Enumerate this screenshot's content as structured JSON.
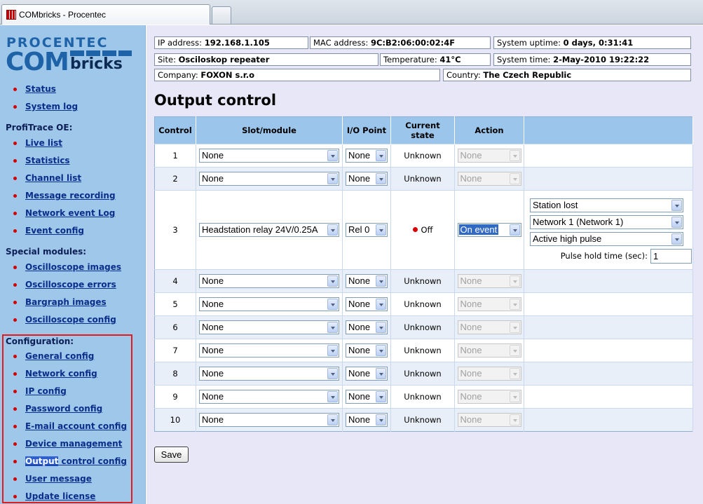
{
  "browser": {
    "tab_title": "COMbricks - Procentec"
  },
  "logo": {
    "top": "PROCENTEC",
    "com": "COM",
    "bricks": "bricks"
  },
  "sidebar": {
    "top_items": [
      "Status",
      "System log"
    ],
    "profitrace_heading": "ProfiTrace OE:",
    "profitrace_items": [
      "Live list",
      "Statistics",
      "Channel list",
      "Message recording",
      "Network event Log",
      "Event config"
    ],
    "special_heading": "Special modules:",
    "special_items": [
      "Oscilloscope images",
      "Oscilloscope errors",
      "Bargraph images",
      "Oscilloscope config"
    ],
    "config_heading": "Configuration:",
    "config_items": [
      "General config",
      "Network config",
      "IP config",
      "Password config",
      "E-mail account config",
      "Device management",
      "Output control config",
      "User message",
      "Update license"
    ],
    "selected_word": "Output",
    "selected_rest": " control config"
  },
  "info": {
    "ip_label": "IP address: ",
    "ip_value": "192.168.1.105",
    "mac_label": "MAC address: ",
    "mac_value": "9C:B2:06:00:02:4F",
    "uptime_label": "System uptime: ",
    "uptime_value": "0 days, 0:31:41",
    "site_label": "Site: ",
    "site_value": "Osciloskop repeater",
    "temp_label": "Temperature: ",
    "temp_value": "41°C",
    "time_label": "System time: ",
    "time_value": "2-May-2010 19:22:22",
    "company_label": "Company: ",
    "company_value": "FOXON s.r.o",
    "country_label": "Country: ",
    "country_value": "The Czech Republic"
  },
  "page_title": "Output control",
  "table": {
    "headers": {
      "control": "Control",
      "slot": "Slot/module",
      "io": "I/O Point",
      "state_line1": "Current",
      "state_line2": "state",
      "action": "Action"
    },
    "rows": [
      {
        "control": "1",
        "slot": "None",
        "io": "None",
        "state": "Unknown",
        "action": "None"
      },
      {
        "control": "2",
        "slot": "None",
        "io": "None",
        "state": "Unknown",
        "action": "None"
      },
      {
        "control": "3",
        "slot": "Headstation relay 24V/0.25A",
        "io": "Rel 0",
        "state": "Off",
        "action": "On event"
      },
      {
        "control": "4",
        "slot": "None",
        "io": "None",
        "state": "Unknown",
        "action": "None"
      },
      {
        "control": "5",
        "slot": "None",
        "io": "None",
        "state": "Unknown",
        "action": "None"
      },
      {
        "control": "6",
        "slot": "None",
        "io": "None",
        "state": "Unknown",
        "action": "None"
      },
      {
        "control": "7",
        "slot": "None",
        "io": "None",
        "state": "Unknown",
        "action": "None"
      },
      {
        "control": "8",
        "slot": "None",
        "io": "None",
        "state": "Unknown",
        "action": "None"
      },
      {
        "control": "9",
        "slot": "None",
        "io": "None",
        "state": "Unknown",
        "action": "None"
      },
      {
        "control": "10",
        "slot": "None",
        "io": "None",
        "state": "Unknown",
        "action": "None"
      }
    ],
    "row3_extra": {
      "event": "Station lost",
      "network": "Network 1 (Network 1)",
      "mode": "Active high pulse",
      "pulse_label": "Pulse hold time (sec):",
      "pulse_value": "1"
    }
  },
  "save_label": "Save",
  "colors": {
    "sidebar_bg": "#9fc7ea",
    "main_bg": "#e7e7f8",
    "header_bg": "#9bc5ea",
    "link": "#0a2e8a",
    "bullet": "#d40000",
    "highlight_frame": "#e21b1b",
    "status_off_dot": "#d80000"
  }
}
